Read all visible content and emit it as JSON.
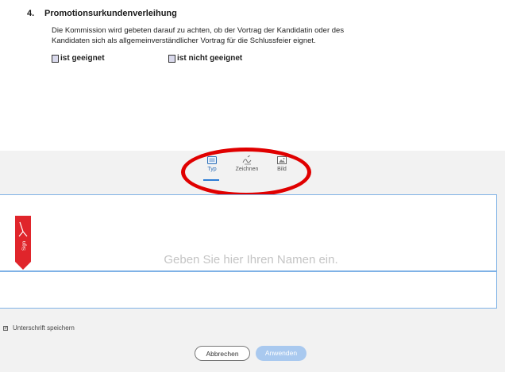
{
  "document": {
    "section_number": "4.",
    "section_title": "Promotionsurkundenverleihung",
    "paragraph_line1": "Die Kommission wird gebeten darauf zu achten, ob der Vortrag der Kandidatin oder des",
    "paragraph_line2": "Kandidaten sich als allgemeinverständlicher Vortrag für die Schlussfeier eignet.",
    "option_suitable": "ist geeignet",
    "option_not_suitable": "ist nicht geeignet"
  },
  "signature_dialog": {
    "tabs": [
      {
        "label": "Typ",
        "icon": "keyboard-icon",
        "active": true
      },
      {
        "label": "Zeichnen",
        "icon": "pen-draw-icon",
        "active": false
      },
      {
        "label": "Bild",
        "icon": "image-icon",
        "active": false
      }
    ],
    "input_placeholder": "Geben Sie hier Ihren Namen ein.",
    "save_signature_label": "Unterschrift speichern",
    "save_signature_checked": true,
    "cancel_label": "Abbrechen",
    "apply_label": "Anwenden",
    "annotation_color": "#e00000",
    "accent_color": "#2d7dd6",
    "flag_color": "#e0252b"
  }
}
